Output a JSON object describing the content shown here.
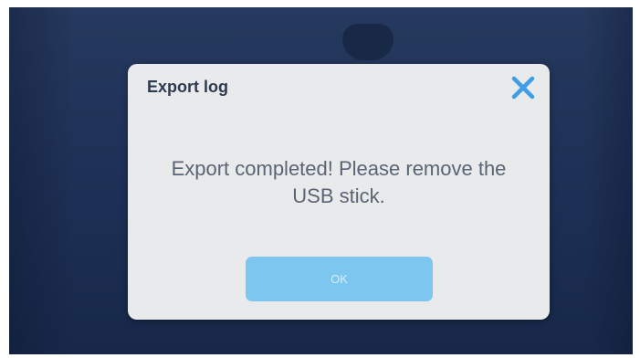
{
  "dialog": {
    "title": "Export log",
    "message": "Export completed! Please remove the USB stick.",
    "ok_label": "OK"
  },
  "icons": {
    "close": "close-icon"
  },
  "colors": {
    "screen_background": "#1f3156",
    "dialog_background": "#e9eaec",
    "accent": "#3f9ee6",
    "ok_button": "#7cc6ef"
  }
}
